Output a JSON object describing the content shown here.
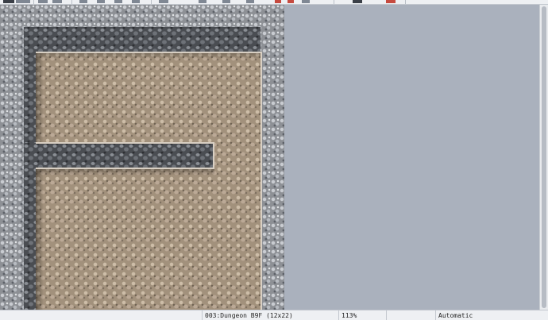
{
  "toolbar": {
    "accent_color": "#c64a3f"
  },
  "map": {
    "floor_color": "#a2917c",
    "wall_color": "#4a4d52",
    "rock_color": "#8d9095",
    "background_color": "#aab1bd"
  },
  "status": {
    "map_name": "003:Dungeon B9F (12x22)",
    "zoom": "113%",
    "mode": "Automatic"
  }
}
